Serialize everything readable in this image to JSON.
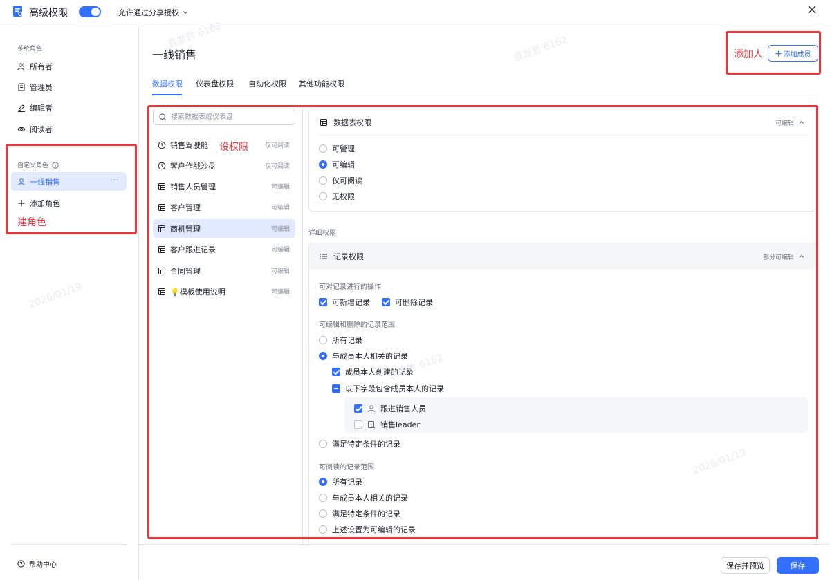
{
  "header": {
    "title": "高级权限",
    "share_toggle_on": true,
    "share_label": "允许通过分享授权"
  },
  "sidebar": {
    "system_roles_title": "系统角色",
    "system_roles": [
      {
        "label": "所有者",
        "icon": "users-icon"
      },
      {
        "label": "管理员",
        "icon": "admin-icon"
      },
      {
        "label": "编辑者",
        "icon": "pencil-icon"
      },
      {
        "label": "阅读者",
        "icon": "eye-icon"
      }
    ],
    "custom_roles_title": "自定义角色",
    "custom_roles": [
      {
        "label": "一线销售",
        "icon": "user-icon",
        "more": "···"
      }
    ],
    "add_role_label": "添加角色",
    "help_label": "帮助中心"
  },
  "annotations": {
    "role": "建角色",
    "permission": "设权限",
    "member": "添加人"
  },
  "main": {
    "role_title": "一线销售",
    "add_member_label": "添加成员",
    "tabs": [
      {
        "label": "数据权限",
        "active": true
      },
      {
        "label": "仪表盘权限",
        "active": false
      },
      {
        "label": "自动化权限",
        "active": false
      },
      {
        "label": "其他功能权限",
        "active": false
      }
    ],
    "search_placeholder": "搜索数据表或仪表盘",
    "tables": [
      {
        "name": "销售驾驶舱",
        "perm": "仅可阅读",
        "icon": "dashboard-icon",
        "active": false
      },
      {
        "name": "客户作战沙盘",
        "perm": "仅可阅读",
        "icon": "dashboard-icon",
        "active": false
      },
      {
        "name": "销售人员管理",
        "perm": "可编辑",
        "icon": "table-icon",
        "active": false
      },
      {
        "name": "客户管理",
        "perm": "可编辑",
        "icon": "table-icon",
        "active": false
      },
      {
        "name": "商机管理",
        "perm": "可编辑",
        "icon": "table-icon",
        "active": true
      },
      {
        "name": "客户跟进记录",
        "perm": "可编辑",
        "icon": "table-icon",
        "active": false
      },
      {
        "name": "合同管理",
        "perm": "可编辑",
        "icon": "table-icon",
        "active": false
      },
      {
        "name": "💡模板使用说明",
        "perm": "可编辑",
        "icon": "table-icon",
        "active": false
      }
    ]
  },
  "table_permission": {
    "title": "数据表权限",
    "status": "可编辑",
    "options": [
      {
        "label": "可管理",
        "selected": false
      },
      {
        "label": "可编辑",
        "selected": true
      },
      {
        "label": "仅可阅读",
        "selected": false
      },
      {
        "label": "无权限",
        "selected": false
      }
    ]
  },
  "detail": {
    "section_label": "详细权限",
    "record_title": "记录权限",
    "record_status": "部分可编辑",
    "ops_label": "可对记录进行的操作",
    "ops": [
      {
        "label": "可新增记录",
        "checked": true
      },
      {
        "label": "可删除记录",
        "checked": true
      }
    ],
    "edit_scope_label": "可编辑和删除的记录范围",
    "edit_scope": {
      "all": "所有记录",
      "related": "与成员本人相关的记录",
      "created": "成员本人创建的记录",
      "fields_contain": "以下字段包含成员本人的记录",
      "fields": [
        {
          "label": "跟进销售人员",
          "checked": true,
          "icon": "person-field-icon"
        },
        {
          "label": "销售leader",
          "checked": false,
          "icon": "lookup-field-icon"
        }
      ],
      "condition": "满足特定条件的记录"
    },
    "read_scope_label": "可阅读的记录范围",
    "read_scope": [
      {
        "label": "所有记录",
        "selected": true
      },
      {
        "label": "与成员本人相关的记录",
        "selected": false
      },
      {
        "label": "满足特定条件的记录",
        "selected": false
      },
      {
        "label": "上述设置为可编辑的记录",
        "selected": false
      }
    ]
  },
  "footer": {
    "save_preview": "保存并预览",
    "save": "保存"
  },
  "watermark_text": [
    "袁发哲 6162",
    "2026/01/19"
  ],
  "colors": {
    "accent": "#3370ff",
    "annotation": "#e8383d",
    "active_bg": "#e1eaff"
  }
}
